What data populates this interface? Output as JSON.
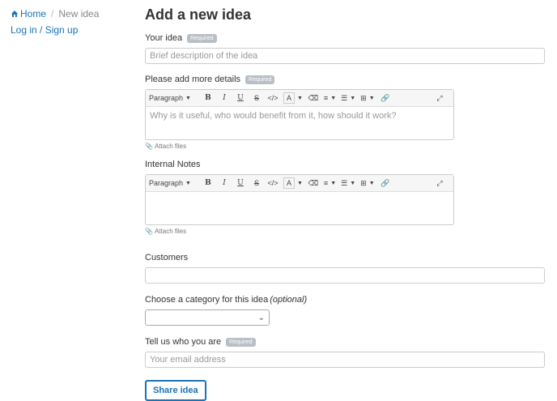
{
  "breadcrumb": {
    "home": "Home",
    "separator": "/",
    "current": "New idea"
  },
  "auth": {
    "login_link": "Log in / Sign up"
  },
  "page": {
    "title": "Add a new idea"
  },
  "idea": {
    "label": "Your idea",
    "badge": "Required",
    "placeholder": "Brief description of the idea"
  },
  "details": {
    "label": "Please add more details",
    "badge": "Required",
    "placeholder": "Why is it useful, who would benefit from it, how should it work?",
    "attach": "Attach files"
  },
  "notes": {
    "label": "Internal Notes",
    "attach": "Attach files"
  },
  "toolbar": {
    "paragraph": "Paragraph",
    "bold": "B",
    "italic": "I",
    "underline": "U",
    "strike": "S",
    "code": "</>",
    "font_color": "A"
  },
  "customers": {
    "label": "Customers"
  },
  "category": {
    "label": "Choose a category for this idea",
    "optional": "(optional)"
  },
  "email": {
    "label": "Tell us who you are",
    "badge": "Required",
    "placeholder": "Your email address"
  },
  "submit": {
    "label": "Share idea"
  },
  "colors": {
    "link": "#1a73b8",
    "badge": "#b9bfc6"
  }
}
